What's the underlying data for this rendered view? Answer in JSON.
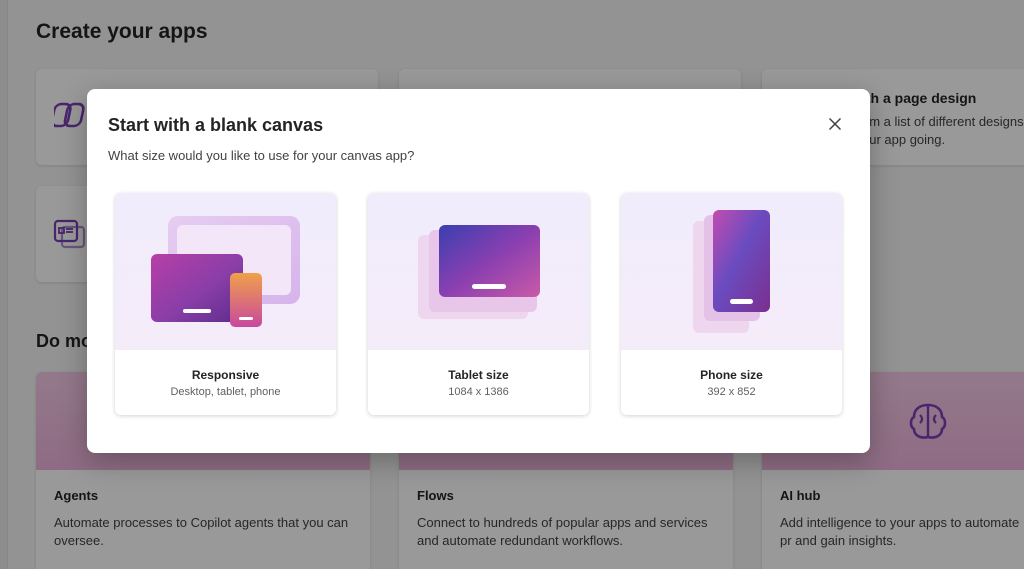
{
  "background": {
    "title": "Create your apps",
    "cards_top": [
      {
        "title": "",
        "text": ""
      },
      {
        "title": "",
        "text": ""
      },
      {
        "title": "ith a page design",
        "text_line1": "om a list of different designs",
        "text_line2": "our app going."
      }
    ],
    "section_title": "Do mo",
    "bottom_cards": [
      {
        "title": "Agents",
        "text": "Automate processes to Copilot agents that you can oversee."
      },
      {
        "title": "Flows",
        "text": "Connect to hundreds of popular apps and services and automate redundant workflows."
      },
      {
        "title": "AI hub",
        "text": "Add intelligence to your apps to automate pr and gain insights."
      }
    ]
  },
  "dialog": {
    "title": "Start with a blank canvas",
    "subtitle": "What size would you like to use for your canvas app?",
    "close_icon": "close-icon",
    "options": [
      {
        "title": "Responsive",
        "subtitle": "Desktop, tablet, phone"
      },
      {
        "title": "Tablet size",
        "subtitle": "1084 x 1386"
      },
      {
        "title": "Phone size",
        "subtitle": "392 x 852"
      }
    ]
  },
  "colors": {
    "accent_purple": "#7a3fb6",
    "banner_pink": "#f1bde1",
    "overlay": "rgba(0,0,0,0.40)"
  }
}
